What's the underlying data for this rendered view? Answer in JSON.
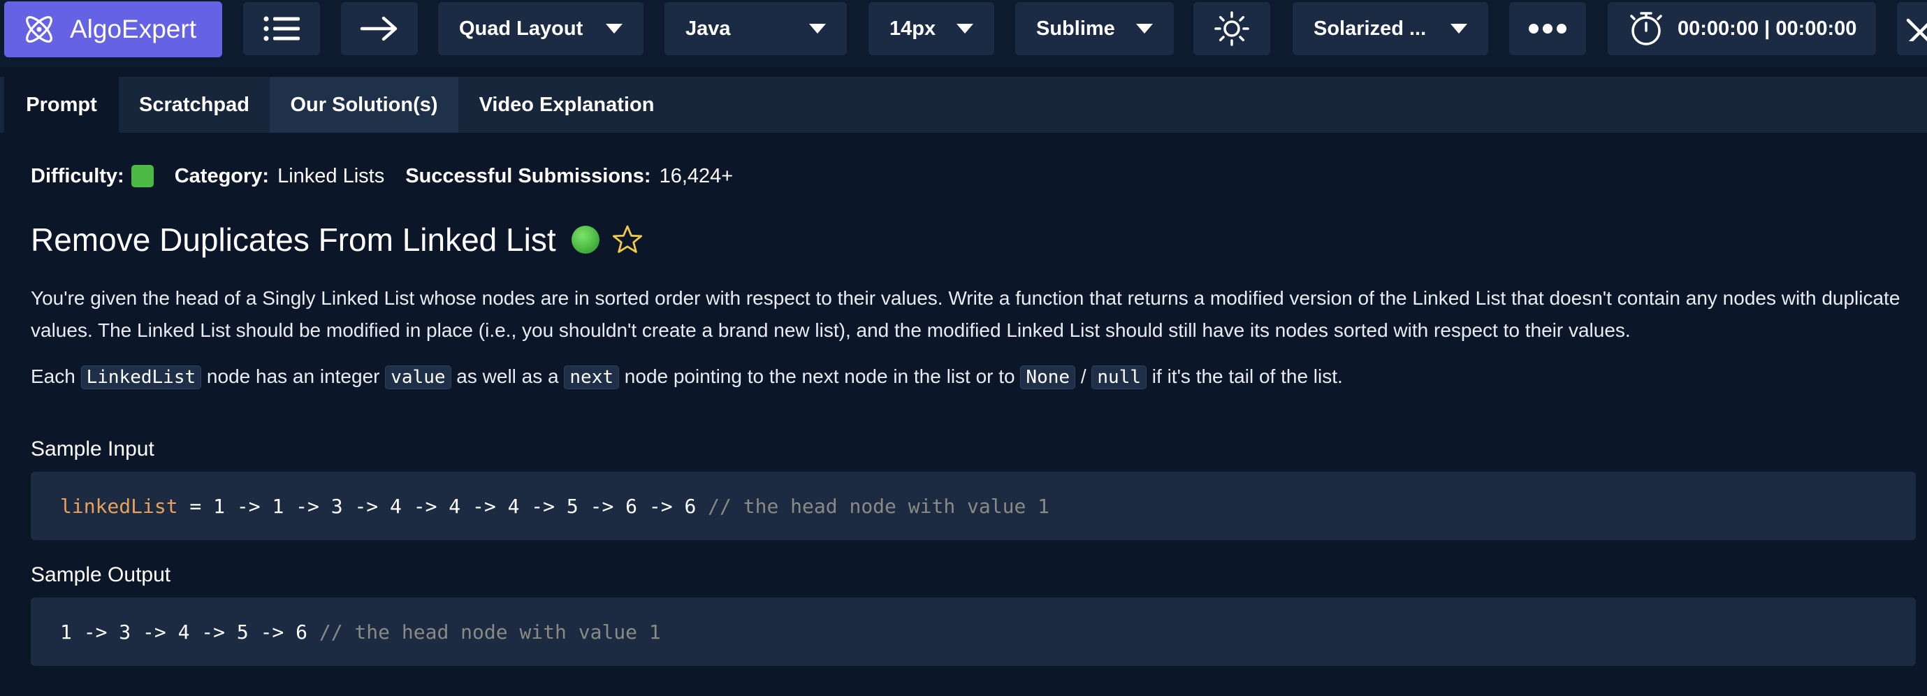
{
  "app": {
    "logo_text": "AlgoExpert"
  },
  "toolbar": {
    "layout": "Quad Layout",
    "language": "Java",
    "font_size": "14px",
    "keybindings": "Sublime",
    "theme": "Solarized ...",
    "timer": "00:00:00 | 00:00:00",
    "icons": [
      "atom-logo-icon",
      "list-icon",
      "arrow-right-icon",
      "sun-icon",
      "more-icon",
      "stopwatch-icon",
      "close-icon"
    ]
  },
  "tabs": [
    "Prompt",
    "Scratchpad",
    "Our Solution(s)",
    "Video Explanation"
  ],
  "meta": {
    "difficulty_label": "Difficulty:",
    "category_label": "Category:",
    "category_value": "Linked Lists",
    "submissions_label": "Successful Submissions:",
    "submissions_value": "16,424+"
  },
  "problem": {
    "title": "Remove Duplicates From Linked List",
    "description_1": "You're given the head of a Singly Linked List whose nodes are in sorted order with respect to their values. Write a function that returns a modified version of the Linked List that doesn't contain any nodes with duplicate values. The Linked List should be modified in place (i.e., you shouldn't create a brand new list), and the modified Linked List should still have its nodes sorted with respect to their values.",
    "description_2": {
      "t1": "Each ",
      "c1": "LinkedList",
      "t2": " node has an integer ",
      "c2": "value",
      "t3": " as well as a ",
      "c3": "next",
      "t4": " node pointing to the next node in the list or to ",
      "c4": "None",
      "t5": " / ",
      "c5": "null",
      "t6": " if it's the tail of the list."
    }
  },
  "sample_input": {
    "heading": "Sample Input",
    "var": "linkedList",
    "code": " = 1 -> 1 -> 3 -> 4 -> 4 -> 4 -> 5 -> 6 -> 6 ",
    "comment": "// the head node with value 1"
  },
  "sample_output": {
    "heading": "Sample Output",
    "code": "1 -> 3 -> 4 -> 5 -> 6 ",
    "comment": "// the head node with value 1"
  },
  "colors": {
    "logo_bg": "#6563e4",
    "difficulty": "#4cb944",
    "star": "#f2c94c",
    "code_var": "#e9a15b",
    "code_comment": "#8a8a84"
  }
}
